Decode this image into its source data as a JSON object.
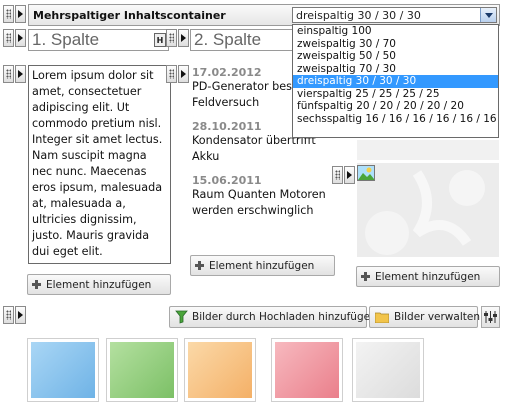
{
  "container": {
    "title": "Mehrspaltiger Inhaltscontainer",
    "layout_select": {
      "value": "dreispaltig 30 / 30 / 30",
      "options": [
        "einspaltig 100",
        "zweispaltig 30 / 70",
        "zweispaltig 50 / 50",
        "zweispaltig 70 / 30",
        "dreispaltig 30 / 30 / 30",
        "vierspaltig 25 / 25 / 25 / 25",
        "fünfspaltig 20 / 20 / 20 / 20 / 20",
        "sechsspaltig 16 / 16 / 16 / 16 / 16 / 16"
      ],
      "selected_index": 4
    }
  },
  "columns": {
    "col1_title": "1. Spalte",
    "col2_title": "2. Spalte",
    "heading_button": "H"
  },
  "text_element": {
    "body": "Lorem ipsum dolor sit amet, consectetuer adipiscing elit. Ut commodo pretium nisl. Integer sit amet lectus. Nam suscipit magna nec nunc. Maecenas eros ipsum, malesuada at, malesuada a, ultricies dignissim, justo. Mauris gravida dui eget elit."
  },
  "news": [
    {
      "date": "17.02.2012",
      "text": "PD-Generator best\nFeldversuch"
    },
    {
      "date": "28.10.2011",
      "text": "Kondensator übertrifft\nAkku"
    },
    {
      "date": "15.06.2011",
      "text": "Raum Quanten Motoren\nwerden erschwinglich"
    }
  ],
  "buttons": {
    "add_element": "Element hinzufügen",
    "upload_images": "Bilder durch Hochladen hinzufügen",
    "manage_images": "Bilder verwalten"
  },
  "colors": {
    "dropdown_selected": "#3399ff",
    "thumb_blue": "#8cc4ee",
    "thumb_green": "#94cf7e",
    "thumb_orange": "#f7c488",
    "thumb_pink": "#f09aa2",
    "thumb_gray": "#e4e4e4"
  },
  "icons": {
    "handle": "grip-icon",
    "expand": "arrow-right-icon",
    "image": "image-icon",
    "upload": "upload-funnel-icon",
    "folder": "folder-icon",
    "settings": "sliders-icon"
  }
}
